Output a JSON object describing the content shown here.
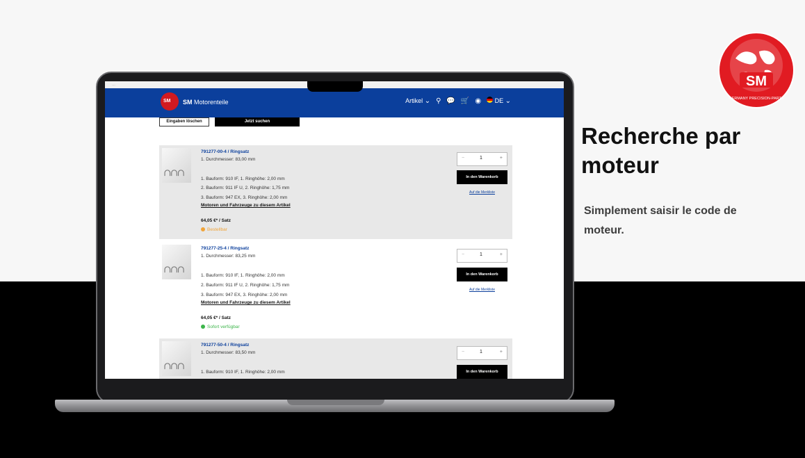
{
  "headline": "Recherche par moteur",
  "subtext": "Simplement saisir le code de moteur.",
  "brand": {
    "main": "SM",
    "ring": "GERMANY PRECISION-PARTS"
  },
  "browser": {
    "url": "…"
  },
  "site": {
    "logo_text": "SM",
    "name_bold": "SM",
    "name_rest": " Motorenteile",
    "nav": {
      "articles": "Artikel",
      "lang": "DE"
    }
  },
  "search": {
    "clear_label": "Eingaben löschen",
    "search_label": "Jetzt suchen"
  },
  "products": [
    {
      "title": "791277-00-4 / Ringsatz",
      "diameter": "1. Durchmesser: 83,00 mm",
      "specs": [
        "1. Bauform: 910 IF, 1. Ringhöhe: 2,00 mm",
        "2. Bauform: 911 IF U, 2. Ringhöhe: 1,75 mm",
        "3. Bauform: 947 EX, 3. Ringhöhe: 2,00 mm"
      ],
      "link": "Motoren und Fahrzeuge zu diesem Artikel",
      "price": "64,05 €* / Satz",
      "availability": "Bestellbar",
      "qty": "1",
      "cart": "In den Warenkorb",
      "wishlist": "Auf die Merkliste"
    },
    {
      "title": "791277-25-4 / Ringsatz",
      "diameter": "1. Durchmesser: 83,25 mm",
      "specs": [
        "1. Bauform: 910 IF, 1. Ringhöhe: 2,00 mm",
        "2. Bauform: 911 IF U, 2. Ringhöhe: 1,75 mm",
        "3. Bauform: 947 EX, 3. Ringhöhe: 2,00 mm"
      ],
      "link": "Motoren und Fahrzeuge zu diesem Artikel",
      "price": "64,05 €* / Satz",
      "availability": "Sofort verfügbar",
      "qty": "1",
      "cart": "In den Warenkorb",
      "wishlist": "Auf die Merkliste"
    },
    {
      "title": "791277-50-4 / Ringsatz",
      "diameter": "1. Durchmesser: 83,50 mm",
      "specs": [
        "1. Bauform: 910 IF, 1. Ringhöhe: 2,00 mm"
      ],
      "qty": "1",
      "cart": "In den Warenkorb"
    }
  ],
  "colors": {
    "nav": "#0b3f9c",
    "brand_red": "#d11a20",
    "avail_orange": "#f0a43a",
    "avail_green": "#3cb54a"
  },
  "icons": [
    "search-icon",
    "chat-icon",
    "cart-icon",
    "user-icon",
    "flag-de-icon",
    "chevron-down-icon"
  ]
}
